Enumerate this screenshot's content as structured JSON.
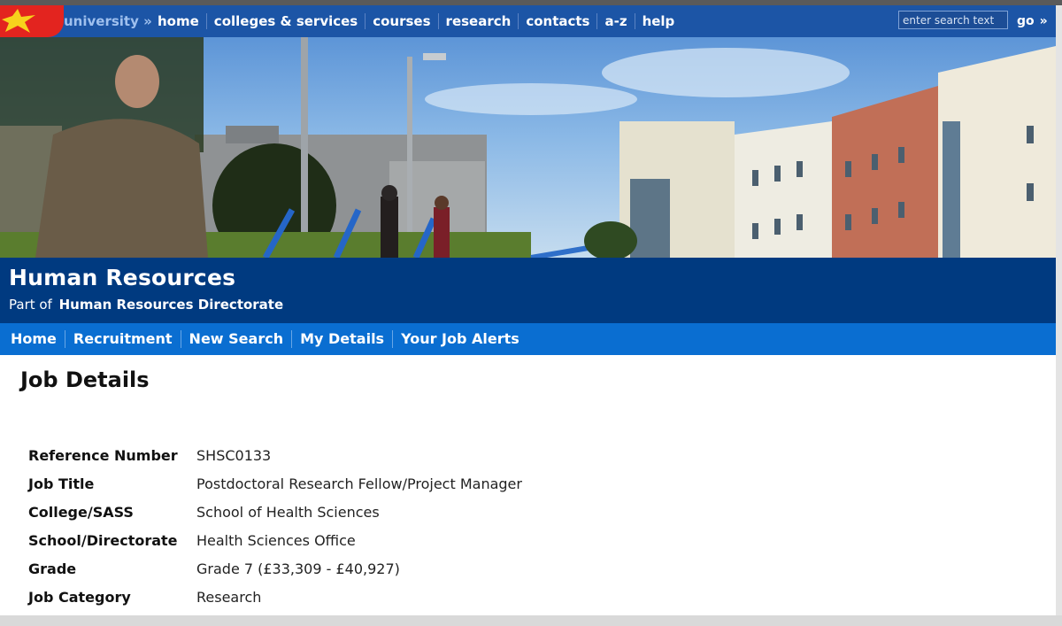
{
  "topnav": {
    "brand": "university »",
    "items": [
      {
        "label": "home"
      },
      {
        "label": "colleges & services"
      },
      {
        "label": "courses"
      },
      {
        "label": "research"
      },
      {
        "label": "contacts"
      },
      {
        "label": "a-z"
      },
      {
        "label": "help"
      }
    ],
    "search_placeholder": "enter search text",
    "go_label": "go",
    "go_arrow": "»"
  },
  "header": {
    "title": "Human Resources",
    "part_of_prefix": "Part of",
    "part_of_link": "Human Resources Directorate"
  },
  "subnav": {
    "items": [
      {
        "label": "Home"
      },
      {
        "label": "Recruitment"
      },
      {
        "label": "New Search"
      },
      {
        "label": "My Details"
      },
      {
        "label": "Your Job Alerts"
      }
    ]
  },
  "main": {
    "title": "Job Details",
    "details": [
      {
        "label": "Reference Number",
        "value": "SHSC0133"
      },
      {
        "label": "Job Title",
        "value": "Postdoctoral Research Fellow/Project Manager"
      },
      {
        "label": "College/SASS",
        "value": "School of Health Sciences"
      },
      {
        "label": "School/Directorate",
        "value": "Health Sciences Office"
      },
      {
        "label": "Grade",
        "value": "Grade 7 (£33,309 - £40,927)"
      },
      {
        "label": "Job Category",
        "value": "Research"
      }
    ]
  },
  "colors": {
    "topbar": "#1c55a6",
    "header": "#003a80",
    "subnav": "#0a6ed1",
    "logo_red": "#e3241f",
    "logo_yellow": "#f7d21c"
  }
}
